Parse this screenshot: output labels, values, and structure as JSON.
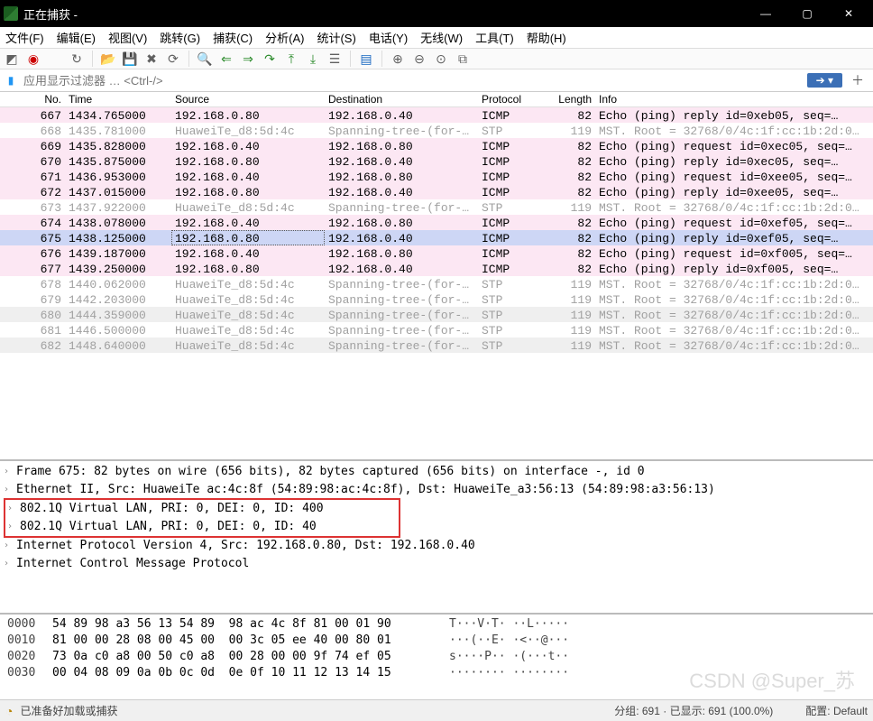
{
  "window": {
    "title": "正在捕获 -"
  },
  "menu": [
    "文件(F)",
    "编辑(E)",
    "视图(V)",
    "跳转(G)",
    "捕获(C)",
    "分析(A)",
    "统计(S)",
    "电话(Y)",
    "无线(W)",
    "工具(T)",
    "帮助(H)"
  ],
  "filter": {
    "placeholder": "应用显示过滤器 … <Ctrl-/>"
  },
  "columns": {
    "no": "No.",
    "time": "Time",
    "src": "Source",
    "dst": "Destination",
    "proto": "Protocol",
    "len": "Length",
    "info": "Info"
  },
  "packets": [
    {
      "no": "667",
      "time": "1434.765000",
      "src": "192.168.0.80",
      "dst": "192.168.0.40",
      "proto": "ICMP",
      "len": "82",
      "info": "Echo (ping) reply    id=0xeb05, seq=…",
      "style": "pink"
    },
    {
      "no": "668",
      "time": "1435.781000",
      "src": "HuaweiTe_d8:5d:4c",
      "dst": "Spanning-tree-(for-…",
      "proto": "STP",
      "len": "119",
      "info": "MST. Root = 32768/0/4c:1f:cc:1b:2d:0…",
      "style": "grey"
    },
    {
      "no": "669",
      "time": "1435.828000",
      "src": "192.168.0.40",
      "dst": "192.168.0.80",
      "proto": "ICMP",
      "len": "82",
      "info": "Echo (ping) request  id=0xec05, seq=…",
      "style": "pink"
    },
    {
      "no": "670",
      "time": "1435.875000",
      "src": "192.168.0.80",
      "dst": "192.168.0.40",
      "proto": "ICMP",
      "len": "82",
      "info": "Echo (ping) reply    id=0xec05, seq=…",
      "style": "pink"
    },
    {
      "no": "671",
      "time": "1436.953000",
      "src": "192.168.0.40",
      "dst": "192.168.0.80",
      "proto": "ICMP",
      "len": "82",
      "info": "Echo (ping) request  id=0xee05, seq=…",
      "style": "pink"
    },
    {
      "no": "672",
      "time": "1437.015000",
      "src": "192.168.0.80",
      "dst": "192.168.0.40",
      "proto": "ICMP",
      "len": "82",
      "info": "Echo (ping) reply    id=0xee05, seq=…",
      "style": "pink"
    },
    {
      "no": "673",
      "time": "1437.922000",
      "src": "HuaweiTe_d8:5d:4c",
      "dst": "Spanning-tree-(for-…",
      "proto": "STP",
      "len": "119",
      "info": "MST. Root = 32768/0/4c:1f:cc:1b:2d:0…",
      "style": "grey"
    },
    {
      "no": "674",
      "time": "1438.078000",
      "src": "192.168.0.40",
      "dst": "192.168.0.80",
      "proto": "ICMP",
      "len": "82",
      "info": "Echo (ping) request  id=0xef05, seq=…",
      "style": "pink"
    },
    {
      "no": "675",
      "time": "1438.125000",
      "src": "192.168.0.80",
      "dst": "192.168.0.40",
      "proto": "ICMP",
      "len": "82",
      "info": "Echo (ping) reply    id=0xef05, seq=…",
      "style": "sel"
    },
    {
      "no": "676",
      "time": "1439.187000",
      "src": "192.168.0.40",
      "dst": "192.168.0.80",
      "proto": "ICMP",
      "len": "82",
      "info": "Echo (ping) request  id=0xf005, seq=…",
      "style": "pink"
    },
    {
      "no": "677",
      "time": "1439.250000",
      "src": "192.168.0.80",
      "dst": "192.168.0.40",
      "proto": "ICMP",
      "len": "82",
      "info": "Echo (ping) reply    id=0xf005, seq=…",
      "style": "pink"
    },
    {
      "no": "678",
      "time": "1440.062000",
      "src": "HuaweiTe_d8:5d:4c",
      "dst": "Spanning-tree-(for-…",
      "proto": "STP",
      "len": "119",
      "info": "MST. Root = 32768/0/4c:1f:cc:1b:2d:0…",
      "style": "grey"
    },
    {
      "no": "679",
      "time": "1442.203000",
      "src": "HuaweiTe_d8:5d:4c",
      "dst": "Spanning-tree-(for-…",
      "proto": "STP",
      "len": "119",
      "info": "MST. Root = 32768/0/4c:1f:cc:1b:2d:0…",
      "style": "grey"
    },
    {
      "no": "680",
      "time": "1444.359000",
      "src": "HuaweiTe_d8:5d:4c",
      "dst": "Spanning-tree-(for-…",
      "proto": "STP",
      "len": "119",
      "info": "MST. Root = 32768/0/4c:1f:cc:1b:2d:0…",
      "style": "grey banded"
    },
    {
      "no": "681",
      "time": "1446.500000",
      "src": "HuaweiTe_d8:5d:4c",
      "dst": "Spanning-tree-(for-…",
      "proto": "STP",
      "len": "119",
      "info": "MST. Root = 32768/0/4c:1f:cc:1b:2d:0…",
      "style": "grey"
    },
    {
      "no": "682",
      "time": "1448.640000",
      "src": "HuaweiTe_d8:5d:4c",
      "dst": "Spanning-tree-(for-…",
      "proto": "STP",
      "len": "119",
      "info": "MST. Root = 32768/0/4c:1f:cc:1b:2d:0…",
      "style": "grey banded"
    }
  ],
  "details": [
    {
      "text": "Frame 675: 82 bytes on wire (656 bits), 82 bytes captured (656 bits) on interface -, id 0",
      "expandable": true,
      "boxed": false
    },
    {
      "text": "Ethernet II, Src: HuaweiTe ac:4c:8f (54:89:98:ac:4c:8f), Dst: HuaweiTe_a3:56:13 (54:89:98:a3:56:13)",
      "expandable": true,
      "boxed": false
    },
    {
      "text": "802.1Q Virtual LAN, PRI: 0, DEI: 0, ID: 400",
      "expandable": true,
      "boxed": true
    },
    {
      "text": "802.1Q Virtual LAN, PRI: 0, DEI: 0, ID: 40",
      "expandable": true,
      "boxed": true
    },
    {
      "text": "Internet Protocol Version 4, Src: 192.168.0.80, Dst: 192.168.0.40",
      "expandable": true,
      "boxed": false
    },
    {
      "text": "Internet Control Message Protocol",
      "expandable": true,
      "boxed": false
    }
  ],
  "hex": [
    {
      "off": "0000",
      "bytes": "54 89 98 a3 56 13 54 89  98 ac 4c 8f 81 00 01 90",
      "asc": "T···V·T· ··L·····"
    },
    {
      "off": "0010",
      "bytes": "81 00 00 28 08 00 45 00  00 3c 05 ee 40 00 80 01",
      "asc": "···(··E· ·<··@···"
    },
    {
      "off": "0020",
      "bytes": "73 0a c0 a8 00 50 c0 a8  00 28 00 00 9f 74 ef 05",
      "asc": "s····P·· ·(···t··"
    },
    {
      "off": "0030",
      "bytes": "00 04 08 09 0a 0b 0c 0d  0e 0f 10 11 12 13 14 15",
      "asc": "········ ········"
    }
  ],
  "status": {
    "left": "已准备好加载或捕获",
    "center": "分组: 691 · 已显示: 691 (100.0%)",
    "right": "配置: Default"
  },
  "watermark": "CSDN @Super_苏"
}
